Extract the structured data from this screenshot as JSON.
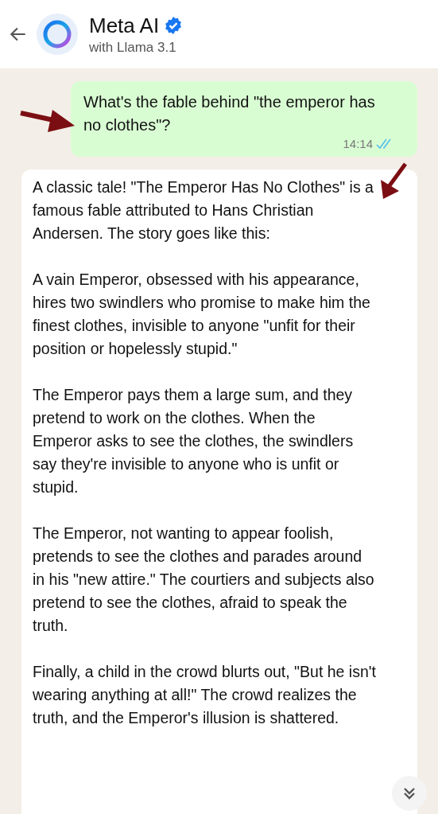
{
  "header": {
    "title": "Meta AI",
    "verified": true,
    "subtitle": "with Llama 3.1"
  },
  "messages": [
    {
      "kind": "sent",
      "text": "What's the fable behind \"the emperor has no clothes\"?",
      "time": "14:14",
      "read": true
    },
    {
      "kind": "received",
      "paragraphs": [
        "A classic tale! \"The Emperor Has No Clothes\" is a famous fable attributed to Hans Christian Andersen. The story goes like this:",
        "A vain Emperor, obsessed with his appearance, hires two swindlers who promise to make him the finest clothes, invisible to anyone \"unfit for their position or hopelessly stupid.\"",
        "The Emperor pays them a large sum, and they pretend to work on the clothes. When the Emperor asks to see the clothes, the swindlers say they're invisible to anyone who is unfit or stupid.",
        "The Emperor, not wanting to appear foolish, pretends to see the clothes and parades around in his \"new attire.\" The courtiers and subjects also pretend to see the clothes, afraid to speak the truth.",
        "Finally, a child in the crowd blurts out, \"But he isn't wearing anything at all!\" The crowd realizes the truth, and the Emperor's illusion is shattered."
      ]
    }
  ]
}
